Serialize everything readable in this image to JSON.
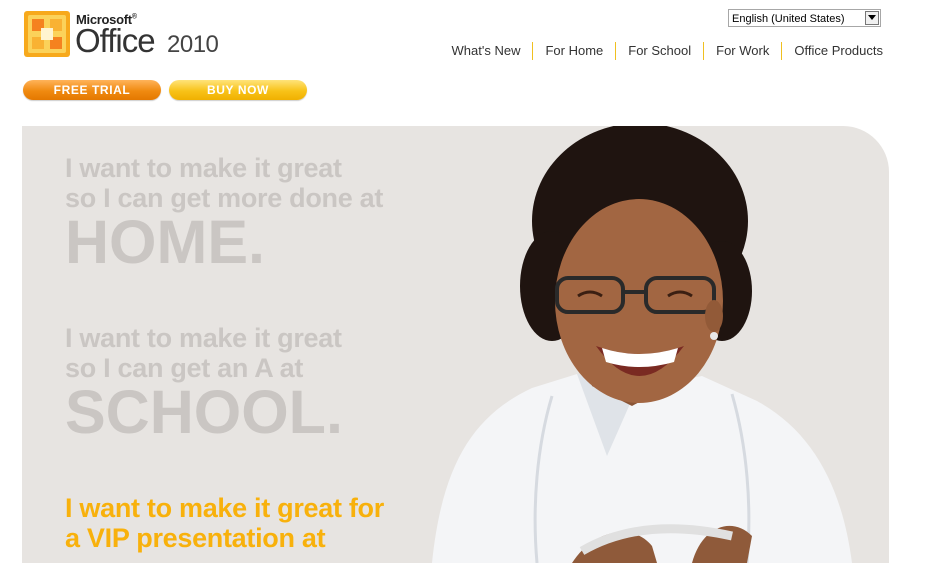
{
  "brand": {
    "microsoft": "Microsoft",
    "product": "Office",
    "version": "2010"
  },
  "language_select": {
    "value": "English (United States)"
  },
  "nav": {
    "items": [
      "What's New",
      "For Home",
      "For School",
      "For Work",
      "Office Products"
    ]
  },
  "actions": {
    "free_trial": "FREE TRIAL",
    "buy_now": "BUY NOW"
  },
  "hero": {
    "home_line1": "I want to make it great",
    "home_line2": "so I can get more done at",
    "home_word": "HOME.",
    "school_line1": "I want to make it great",
    "school_line2": "so I can get an A at",
    "school_word": "SCHOOL.",
    "vip_line1": "I want to make it great for",
    "vip_line2": "a VIP presentation at"
  },
  "colors": {
    "nav_divider": "#f0c020",
    "trial_button": "#f08a10",
    "buy_button": "#f8c218",
    "hero_background": "#e7e4e1",
    "hero_text_faded": "#cac6c3",
    "hero_text_highlight": "#f8b10c"
  },
  "icons": {
    "logo": "office-logo-icon",
    "dropdown": "chevron-down-icon"
  }
}
